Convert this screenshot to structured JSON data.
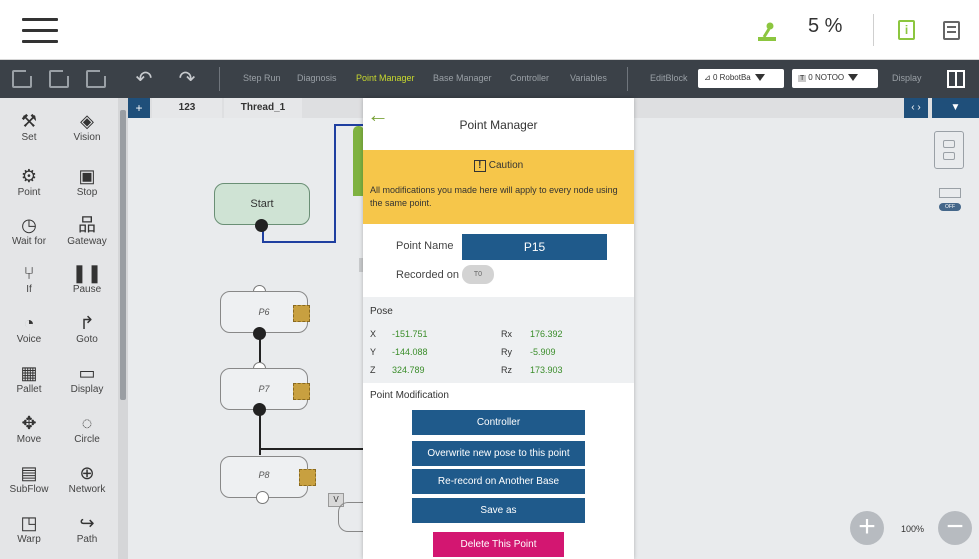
{
  "topbar": {
    "speed": "5 %"
  },
  "toolbar": {
    "links": [
      "Step Run",
      "Diagnosis",
      "Point Manager",
      "Base Manager",
      "Controller",
      "Variables"
    ],
    "editblock": "EditBlock",
    "robot_base_select": "0 RobotBa",
    "tool_select_badge": "T",
    "tool_select": "0 NOTOO",
    "display": "Display"
  },
  "palette": {
    "items": [
      {
        "label": "Set",
        "icon": "tools-icon"
      },
      {
        "label": "Vision",
        "icon": "eye-icon"
      },
      {
        "label": "Point",
        "icon": "robot-arm-icon"
      },
      {
        "label": "Stop",
        "icon": "stop-icon"
      },
      {
        "label": "Wait for",
        "icon": "clock-icon"
      },
      {
        "label": "Gateway",
        "icon": "hierarchy-icon"
      },
      {
        "label": "If",
        "icon": "fork-icon"
      },
      {
        "label": "Pause",
        "icon": "pause-icon"
      },
      {
        "label": "Voice",
        "icon": "voice-icon"
      },
      {
        "label": "Goto",
        "icon": "goto-arrow-icon"
      },
      {
        "label": "Pallet",
        "icon": "grid-icon"
      },
      {
        "label": "Display",
        "icon": "display-icon"
      },
      {
        "label": "Move",
        "icon": "move-arrows-icon"
      },
      {
        "label": "Circle",
        "icon": "dashed-circle-icon"
      },
      {
        "label": "SubFlow",
        "icon": "subflow-icon"
      },
      {
        "label": "Network",
        "icon": "globe-icon"
      },
      {
        "label": "Warp",
        "icon": "warp-icon"
      },
      {
        "label": "Path",
        "icon": "path-icon"
      }
    ]
  },
  "canvas": {
    "tabs": [
      "123",
      "Thread_1"
    ],
    "plus": "+",
    "nodes": {
      "start": "Start",
      "p6": "P6",
      "p7": "P7",
      "p8": "P8"
    },
    "v_label": "V",
    "zoom": "100%"
  },
  "modal": {
    "title": "Point Manager",
    "caution_title": "Caution",
    "caution_message": "All modifications you made here will apply to every node using the same point.",
    "point_name_label": "Point Name",
    "point_name": "P15",
    "recorded_on_label": "Recorded on",
    "recorded_on_value": "T0",
    "pose_title": "Pose",
    "pose": {
      "x_label": "X",
      "x": "-151.751",
      "y_label": "Y",
      "y": "-144.088",
      "z_label": "Z",
      "z": "324.789",
      "rx_label": "Rx",
      "rx": "176.392",
      "ry_label": "Ry",
      "ry": "-5.909",
      "rz_label": "Rz",
      "rz": "173.903"
    },
    "point_modification_title": "Point Modification",
    "buttons": {
      "controller": "Controller",
      "overwrite": "Overwrite new pose to this point",
      "rerecord": "Re-record on Another Base",
      "save_as": "Save as",
      "delete": "Delete This Point"
    }
  }
}
